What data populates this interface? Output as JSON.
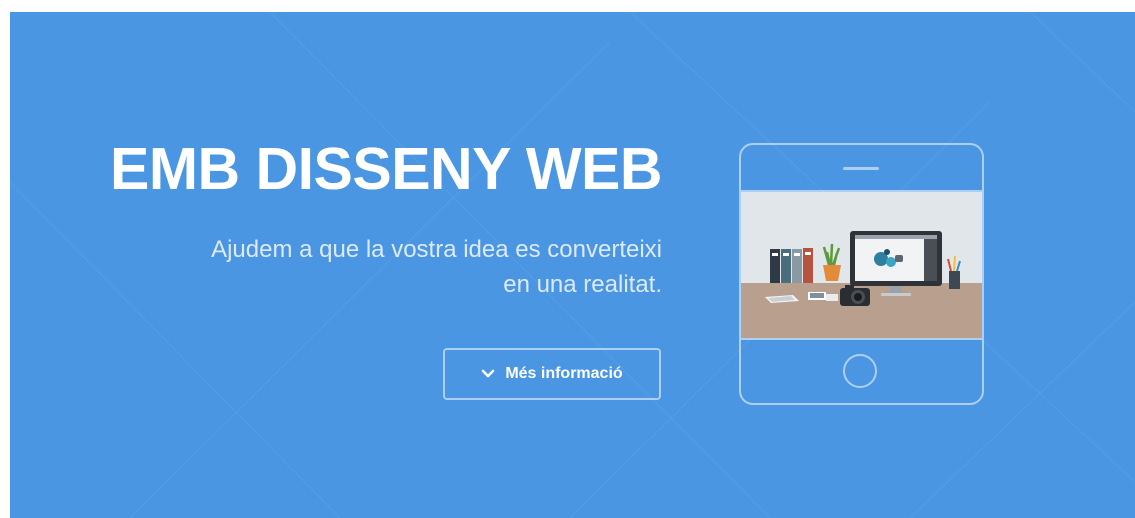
{
  "hero": {
    "title": "EMB DISSENY WEB",
    "subtitle_line1": "Ajudem a que la vostra idea es converteixi",
    "subtitle_line2": "en una realitat.",
    "button_label": "Més informació",
    "button_icon": "chevron-down-icon",
    "background_color": "#4a96e3"
  },
  "illustration": {
    "device_icon": "tablet-icon",
    "scene": "desk-workspace-illustration"
  }
}
